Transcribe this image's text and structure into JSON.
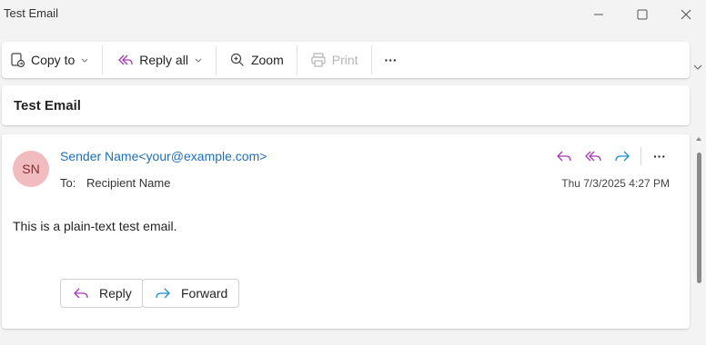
{
  "window": {
    "title": "Test Email",
    "controls": [
      "minimize-icon",
      "maximize-icon",
      "close-icon"
    ]
  },
  "toolbar": {
    "copy_to": "Copy to",
    "reply_all": "Reply all",
    "zoom": "Zoom",
    "print": "Print",
    "more": "···"
  },
  "subject": "Test Email",
  "message": {
    "avatar_initials": "SN",
    "avatar_color": "#f1bcbf",
    "sender": "Sender Name<your@example.com>",
    "to_label": "To:",
    "recipient": "Recipient Name",
    "date": "Thu 7/3/2025 4:27 PM",
    "body": "This is a plain-text test email.",
    "reply_label": "Reply",
    "forward_label": "Forward",
    "more": "···"
  },
  "colors": {
    "accent_purple": "#a33bb0",
    "accent_blue": "#1f6fb7",
    "forward_cyan": "#1e8fc7"
  }
}
